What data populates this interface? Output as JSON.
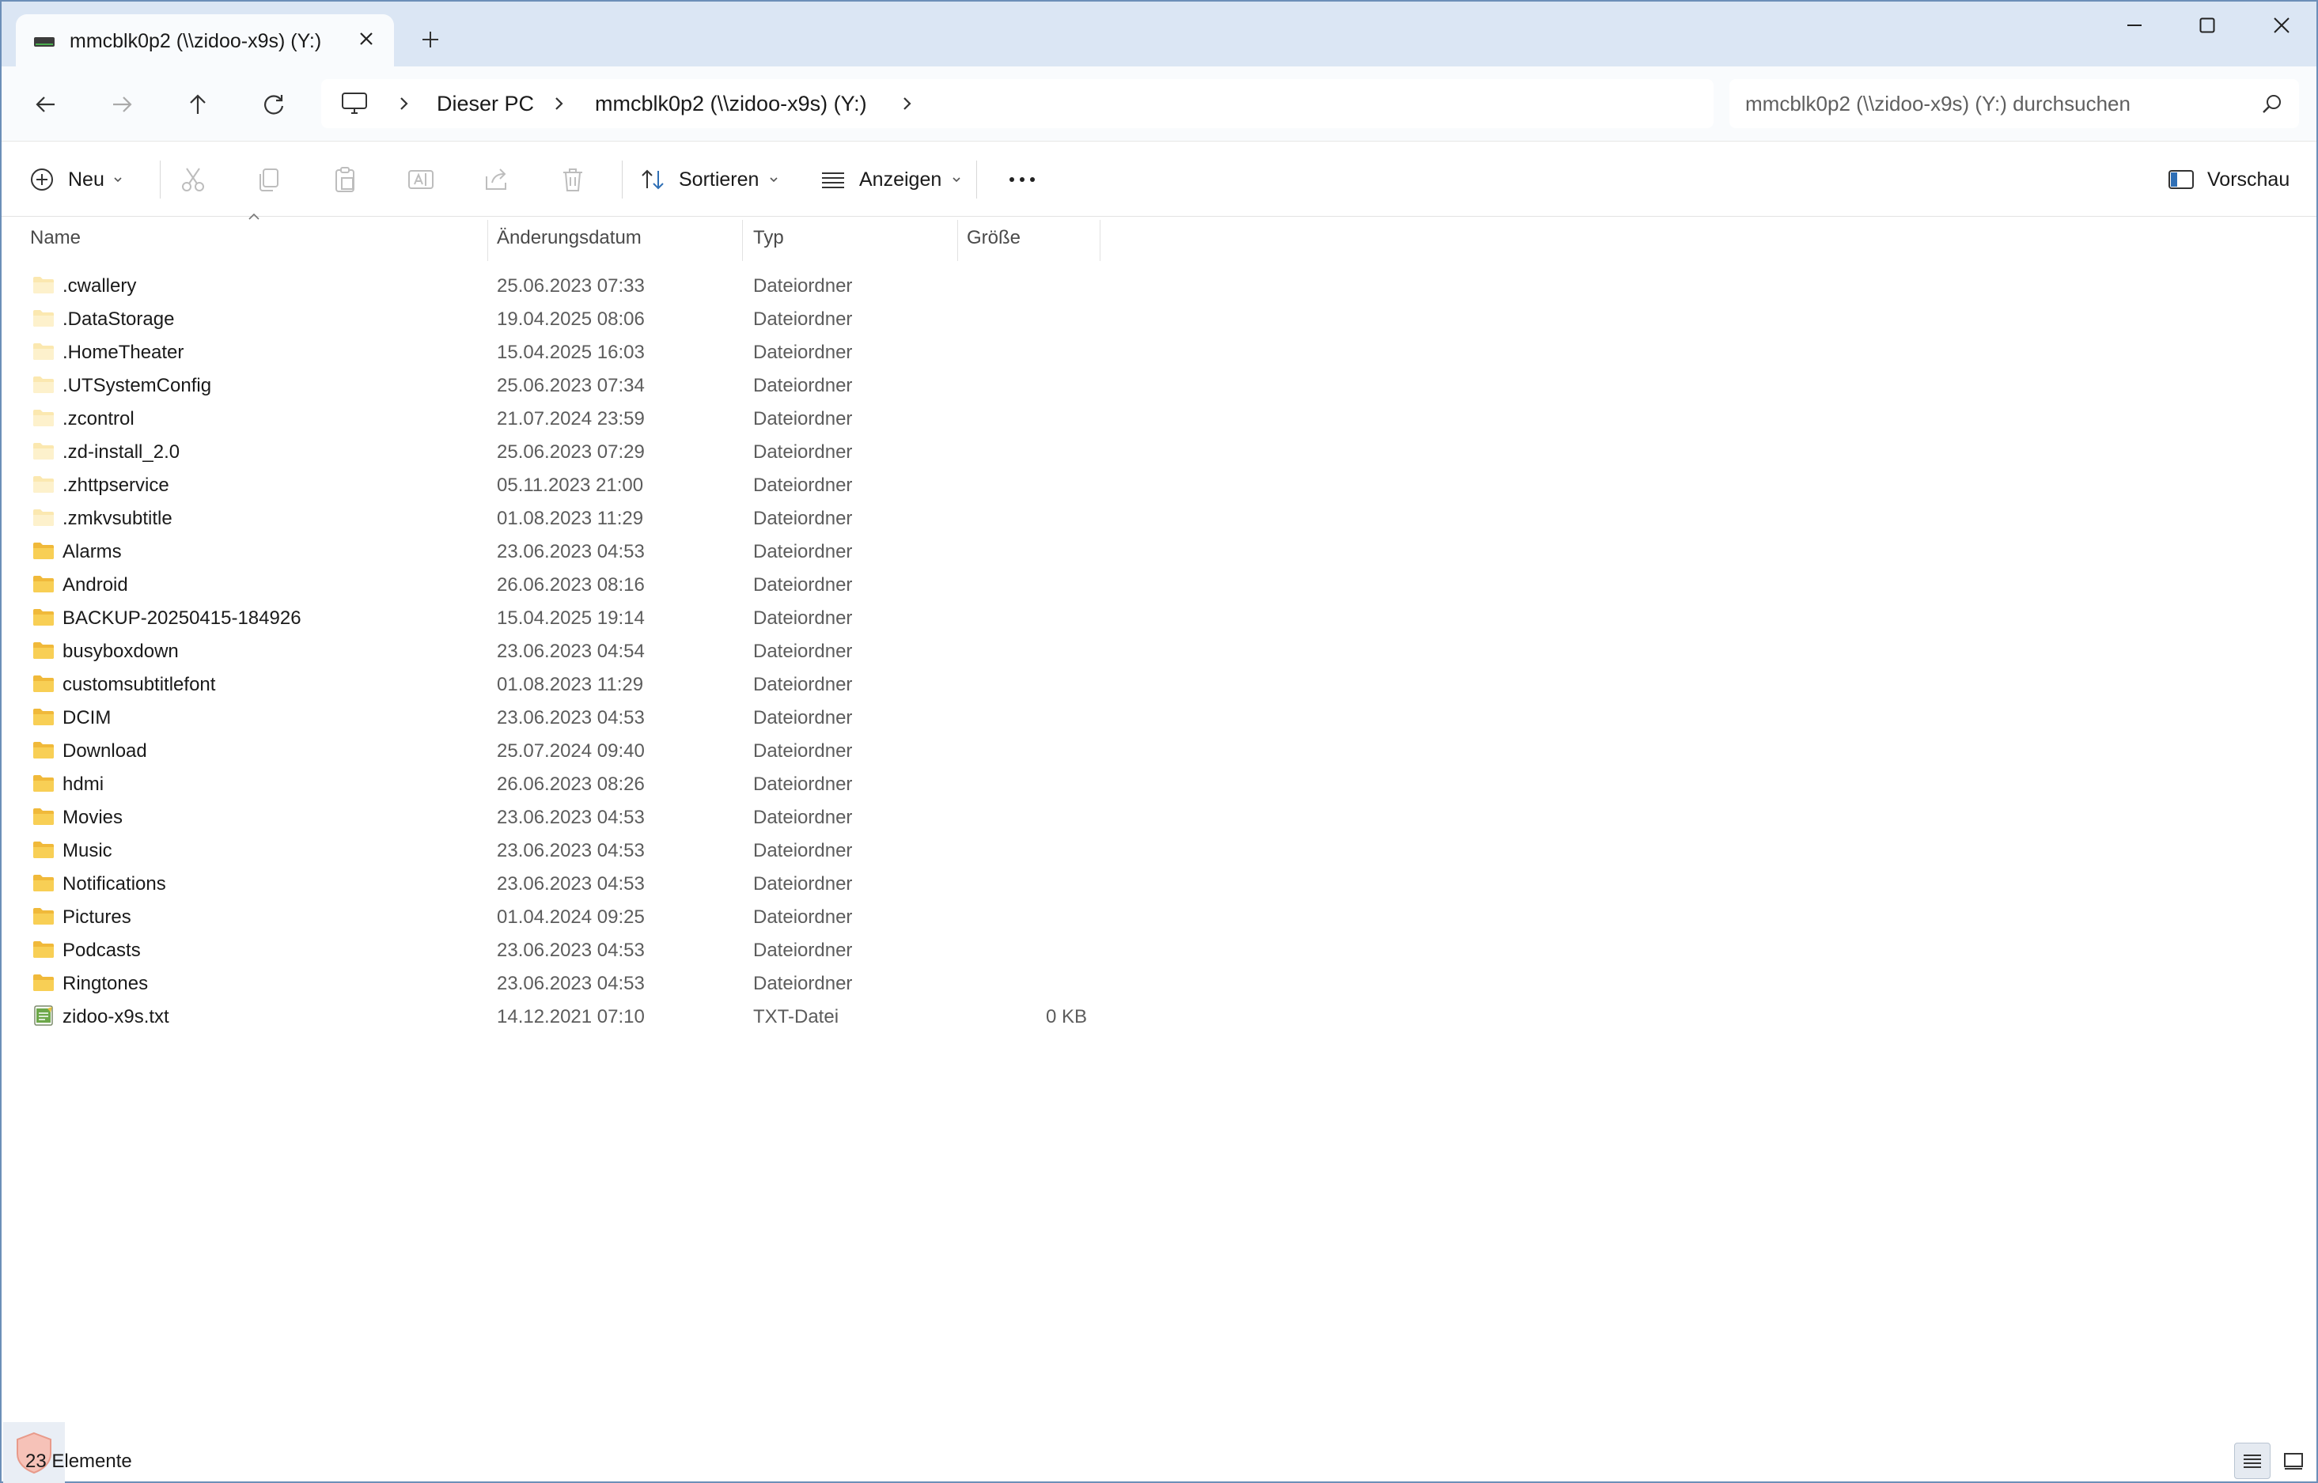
{
  "tab": {
    "title": "mmcblk0p2 (\\\\zidoo-x9s) (Y:)"
  },
  "address": {
    "crumbs": [
      "Dieser PC",
      "mmcblk0p2 (\\\\zidoo-x9s) (Y:)"
    ]
  },
  "search": {
    "placeholder": "mmcblk0p2 (\\\\zidoo-x9s) (Y:) durchsuchen"
  },
  "toolbar": {
    "new_label": "Neu",
    "sort_label": "Sortieren",
    "view_label": "Anzeigen",
    "preview_label": "Vorschau"
  },
  "columns": {
    "name": "Name",
    "date": "Änderungsdatum",
    "type": "Typ",
    "size": "Größe"
  },
  "files": [
    {
      "name": ".cwallery",
      "date": "25.06.2023 07:33",
      "type": "Dateiordner",
      "size": "",
      "icon": "folder-hidden"
    },
    {
      "name": ".DataStorage",
      "date": "19.04.2025 08:06",
      "type": "Dateiordner",
      "size": "",
      "icon": "folder-hidden"
    },
    {
      "name": ".HomeTheater",
      "date": "15.04.2025 16:03",
      "type": "Dateiordner",
      "size": "",
      "icon": "folder-hidden"
    },
    {
      "name": ".UTSystemConfig",
      "date": "25.06.2023 07:34",
      "type": "Dateiordner",
      "size": "",
      "icon": "folder-hidden"
    },
    {
      "name": ".zcontrol",
      "date": "21.07.2024 23:59",
      "type": "Dateiordner",
      "size": "",
      "icon": "folder-hidden"
    },
    {
      "name": ".zd-install_2.0",
      "date": "25.06.2023 07:29",
      "type": "Dateiordner",
      "size": "",
      "icon": "folder-hidden"
    },
    {
      "name": ".zhttpservice",
      "date": "05.11.2023 21:00",
      "type": "Dateiordner",
      "size": "",
      "icon": "folder-hidden"
    },
    {
      "name": ".zmkvsubtitle",
      "date": "01.08.2023 11:29",
      "type": "Dateiordner",
      "size": "",
      "icon": "folder-hidden"
    },
    {
      "name": "Alarms",
      "date": "23.06.2023 04:53",
      "type": "Dateiordner",
      "size": "",
      "icon": "folder"
    },
    {
      "name": "Android",
      "date": "26.06.2023 08:16",
      "type": "Dateiordner",
      "size": "",
      "icon": "folder"
    },
    {
      "name": "BACKUP-20250415-184926",
      "date": "15.04.2025 19:14",
      "type": "Dateiordner",
      "size": "",
      "icon": "folder"
    },
    {
      "name": "busyboxdown",
      "date": "23.06.2023 04:54",
      "type": "Dateiordner",
      "size": "",
      "icon": "folder"
    },
    {
      "name": "customsubtitlefont",
      "date": "01.08.2023 11:29",
      "type": "Dateiordner",
      "size": "",
      "icon": "folder"
    },
    {
      "name": "DCIM",
      "date": "23.06.2023 04:53",
      "type": "Dateiordner",
      "size": "",
      "icon": "folder"
    },
    {
      "name": "Download",
      "date": "25.07.2024 09:40",
      "type": "Dateiordner",
      "size": "",
      "icon": "folder"
    },
    {
      "name": "hdmi",
      "date": "26.06.2023 08:26",
      "type": "Dateiordner",
      "size": "",
      "icon": "folder"
    },
    {
      "name": "Movies",
      "date": "23.06.2023 04:53",
      "type": "Dateiordner",
      "size": "",
      "icon": "folder"
    },
    {
      "name": "Music",
      "date": "23.06.2023 04:53",
      "type": "Dateiordner",
      "size": "",
      "icon": "folder"
    },
    {
      "name": "Notifications",
      "date": "23.06.2023 04:53",
      "type": "Dateiordner",
      "size": "",
      "icon": "folder"
    },
    {
      "name": "Pictures",
      "date": "01.04.2024 09:25",
      "type": "Dateiordner",
      "size": "",
      "icon": "folder"
    },
    {
      "name": "Podcasts",
      "date": "23.06.2023 04:53",
      "type": "Dateiordner",
      "size": "",
      "icon": "folder"
    },
    {
      "name": "Ringtones",
      "date": "23.06.2023 04:53",
      "type": "Dateiordner",
      "size": "",
      "icon": "folder"
    },
    {
      "name": "zidoo-x9s.txt",
      "date": "14.12.2021 07:10",
      "type": "TXT-Datei",
      "size": "0 KB",
      "icon": "text-file"
    }
  ],
  "status": {
    "count": "23 Elemente"
  },
  "colors": {
    "titlebar": "#dbe6f4",
    "folder": "#f5c542",
    "accent": "#2f6fb5"
  }
}
